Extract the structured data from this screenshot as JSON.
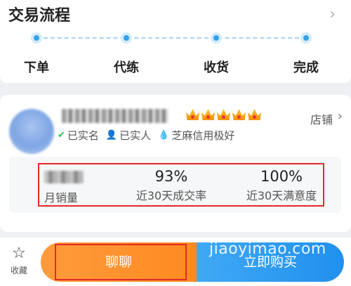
{
  "process": {
    "title": "交易流程",
    "steps": [
      {
        "label": "下单"
      },
      {
        "label": "代练"
      },
      {
        "label": "收货"
      },
      {
        "label": "完成"
      }
    ]
  },
  "shop": {
    "store_link": "店铺",
    "crown_count": 5,
    "badges": [
      {
        "icon": "shield-check-icon",
        "label": "已实名"
      },
      {
        "icon": "person-icon",
        "label": "已实人"
      },
      {
        "icon": "flame-icon",
        "label": "芝麻信用极好"
      }
    ],
    "stats": [
      {
        "value": "",
        "label": "月销量"
      },
      {
        "value": "93%",
        "label": "近30天成交率"
      },
      {
        "value": "100%",
        "label": "近30天满意度"
      }
    ]
  },
  "bottom": {
    "favorite_label": "收藏",
    "chat_label": "聊聊",
    "buy_label": "立即购买"
  },
  "watermark": "jiaoyimao.com",
  "colors": {
    "accent_blue": "#1f90ee",
    "accent_orange": "#ff8a20",
    "highlight_red": "#e32a2a",
    "crown_gold": "#f29000"
  }
}
